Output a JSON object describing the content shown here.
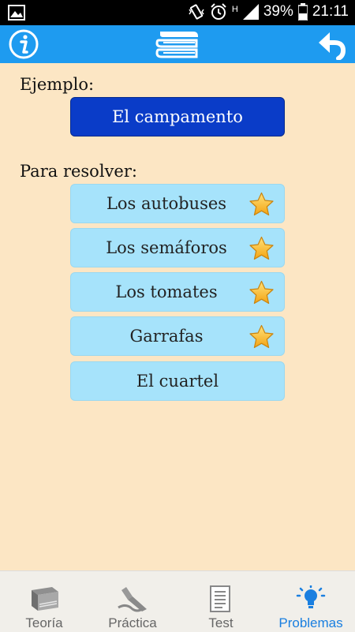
{
  "status_bar": {
    "battery": "39%",
    "time": "21:11",
    "network": "H",
    "icons": [
      "image-icon",
      "vibrate-icon",
      "alarm-icon",
      "signal-icon",
      "battery-icon"
    ]
  },
  "app_bar": {
    "icons": [
      "info-icon",
      "books-icon",
      "back-arrow-icon"
    ],
    "color": "#1e9bf0"
  },
  "main": {
    "example_label": "Ejemplo:",
    "example_button": "El campamento",
    "problems_label": "Para resolver:",
    "problems": [
      {
        "label": "Los autobuses",
        "starred": true
      },
      {
        "label": "Los semáforos",
        "starred": true
      },
      {
        "label": "Los tomates",
        "starred": true
      },
      {
        "label": "Garrafas",
        "starred": true
      },
      {
        "label": "El cuartel",
        "starred": false
      }
    ]
  },
  "bottom_nav": {
    "items": [
      {
        "label": "Teoría",
        "icon": "book-icon",
        "active": false
      },
      {
        "label": "Práctica",
        "icon": "pen-icon",
        "active": false
      },
      {
        "label": "Test",
        "icon": "checklist-icon",
        "active": false
      },
      {
        "label": "Problemas",
        "icon": "lightbulb-icon",
        "active": true
      }
    ],
    "active_color": "#1a7fe0"
  }
}
